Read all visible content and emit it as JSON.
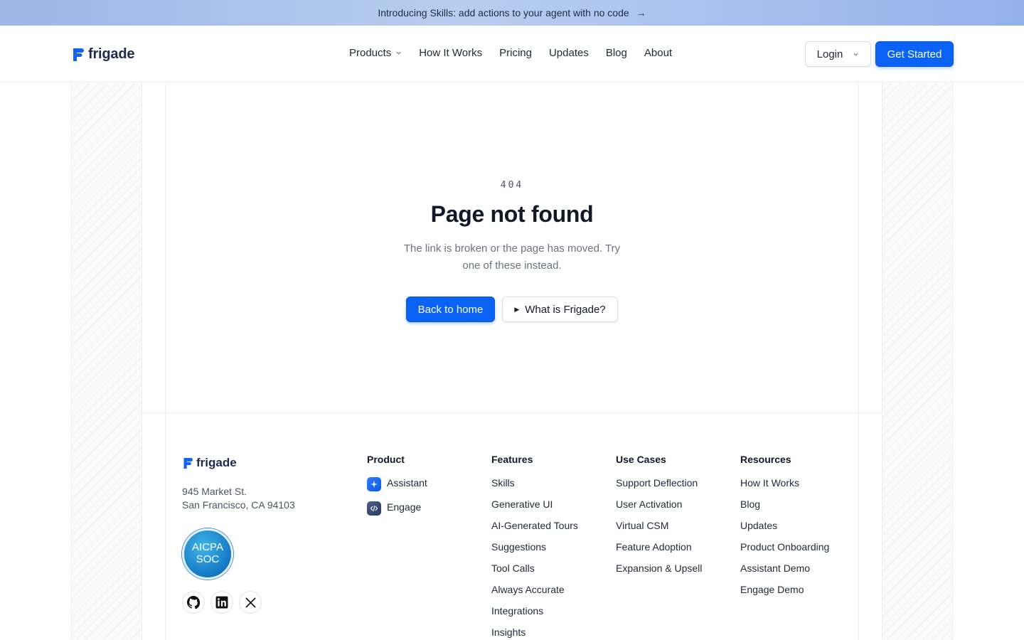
{
  "announcement": {
    "text": "Introducing Skills: add actions to your agent with no code",
    "arrow": "→"
  },
  "header": {
    "brand": "frigade",
    "nav": [
      {
        "label": "Products",
        "has_dropdown": true
      },
      {
        "label": "How It Works"
      },
      {
        "label": "Pricing"
      },
      {
        "label": "Updates"
      },
      {
        "label": "Blog"
      },
      {
        "label": "About"
      }
    ],
    "login_label": "Login",
    "cta_label": "Get Started"
  },
  "main": {
    "code": "404",
    "title": "Page not found",
    "description": "The link is broken or the page has moved. Try one of these instead.",
    "primary_button": "Back to home",
    "secondary_button": "What is Frigade?"
  },
  "footer": {
    "brand": "frigade",
    "address_line1": "945 Market St.",
    "address_line2": "San Francisco, CA 94103",
    "badge": {
      "line1": "AICPA",
      "line2": "SOC"
    },
    "socials": [
      "github-icon",
      "linkedin-icon",
      "x-icon"
    ],
    "columns": {
      "product": {
        "heading": "Product",
        "items": [
          "Assistant",
          "Engage"
        ]
      },
      "features": {
        "heading": "Features",
        "items": [
          "Skills",
          "Generative UI",
          "AI-Generated Tours",
          "Suggestions",
          "Tool Calls",
          "Always Accurate",
          "Integrations",
          "Insights"
        ]
      },
      "use_cases": {
        "heading": "Use Cases",
        "items": [
          "Support Deflection",
          "User Activation",
          "Virtual CSM",
          "Feature Adoption",
          "Expansion & Upsell"
        ]
      },
      "resources": {
        "heading": "Resources",
        "items": [
          "How It Works",
          "Blog",
          "Updates",
          "Product Onboarding",
          "Assistant Demo",
          "Engage Demo"
        ]
      }
    }
  },
  "colors": {
    "brand_blue": "#0b63f5",
    "navy": "#1d2b4f"
  }
}
